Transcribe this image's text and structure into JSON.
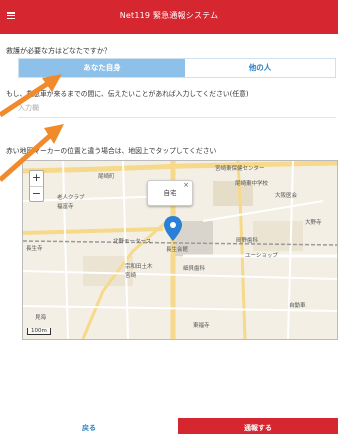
{
  "header": {
    "title": "Net119 緊急通報システム"
  },
  "question1": {
    "label": "救護が必要な方はどなたですか？",
    "options": [
      "あなた自身",
      "他の人"
    ],
    "selected": 0
  },
  "question2": {
    "label": "もし、救急車が来るまでの間に、伝えたいことがあれば入力してください(任意)",
    "placeholder": "入力欄"
  },
  "question3": {
    "label": "赤い地図マーカーの位置と違う場合は、地図上でタップしてください"
  },
  "map": {
    "popup_text": "自宅",
    "popup_close": "×",
    "zoom_in": "+",
    "zoom_out": "−",
    "scale": "100m",
    "labels": {
      "l1": "尾崎町",
      "l2": "老人クラブ",
      "l3": "福富寺",
      "l4": "尾崎東中学校",
      "l5": "北野モータース",
      "l6": "長生会館",
      "l7": "岡野歯科",
      "l8": "ユーショップ",
      "l9": "細貝歯科",
      "l10": "宗和田土木",
      "l11": "宮崎",
      "l12": "保健センター",
      "l13": "大阪医会",
      "l14": "大野寺",
      "l15": "長生寺",
      "l16": "東寺",
      "l17": "尾崎町",
      "l18": "自動車",
      "l19": "東福寺",
      "l20": "宮崎東保健センター",
      "l21": "見海"
    }
  },
  "footer": {
    "back": "戻る",
    "submit": "通報する"
  },
  "colors": {
    "primary_red": "#d6262f",
    "selected_blue": "#8ec1ea",
    "link_blue": "#2f7fc1",
    "arrow_orange": "#f08a2a",
    "map_marker_blue": "#2a7fd6"
  }
}
